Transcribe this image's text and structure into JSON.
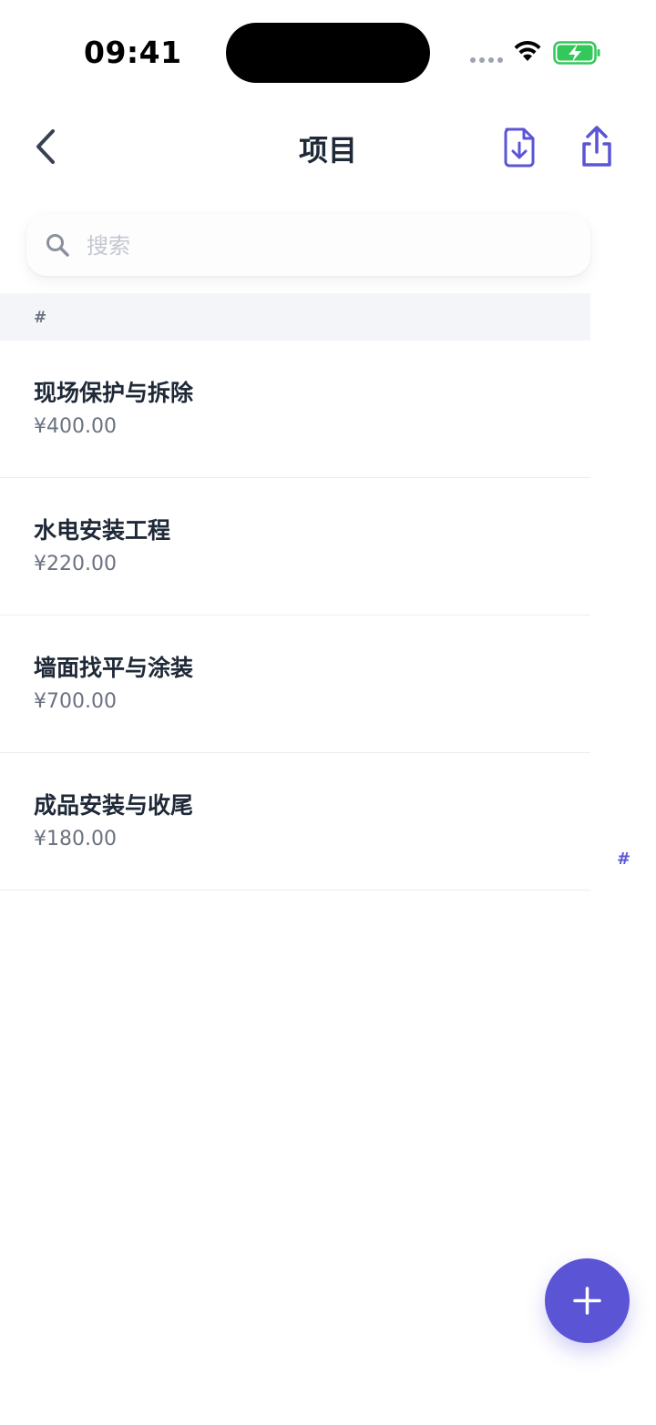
{
  "status_bar": {
    "time": "09:41"
  },
  "nav": {
    "title": "项目"
  },
  "search": {
    "placeholder": "搜索"
  },
  "section": {
    "letter": "#"
  },
  "items": [
    {
      "name": "现场保护与拆除",
      "price": "¥400.00"
    },
    {
      "name": "水电安装工程",
      "price": "¥220.00"
    },
    {
      "name": "墙面找平与涂装",
      "price": "¥700.00"
    },
    {
      "name": "成品安装与收尾",
      "price": "¥180.00"
    }
  ],
  "index": {
    "letters": [
      "#"
    ]
  },
  "colors": {
    "accent": "#5b55d6",
    "title_text": "#1f2937",
    "secondary_text": "#6b7280",
    "section_background": "#f4f5f8",
    "battery_green": "#34c759"
  },
  "icons": {
    "back": "chevron-left-icon",
    "import": "file-download-icon",
    "share": "share-icon",
    "search": "search-icon",
    "add": "plus-icon"
  }
}
